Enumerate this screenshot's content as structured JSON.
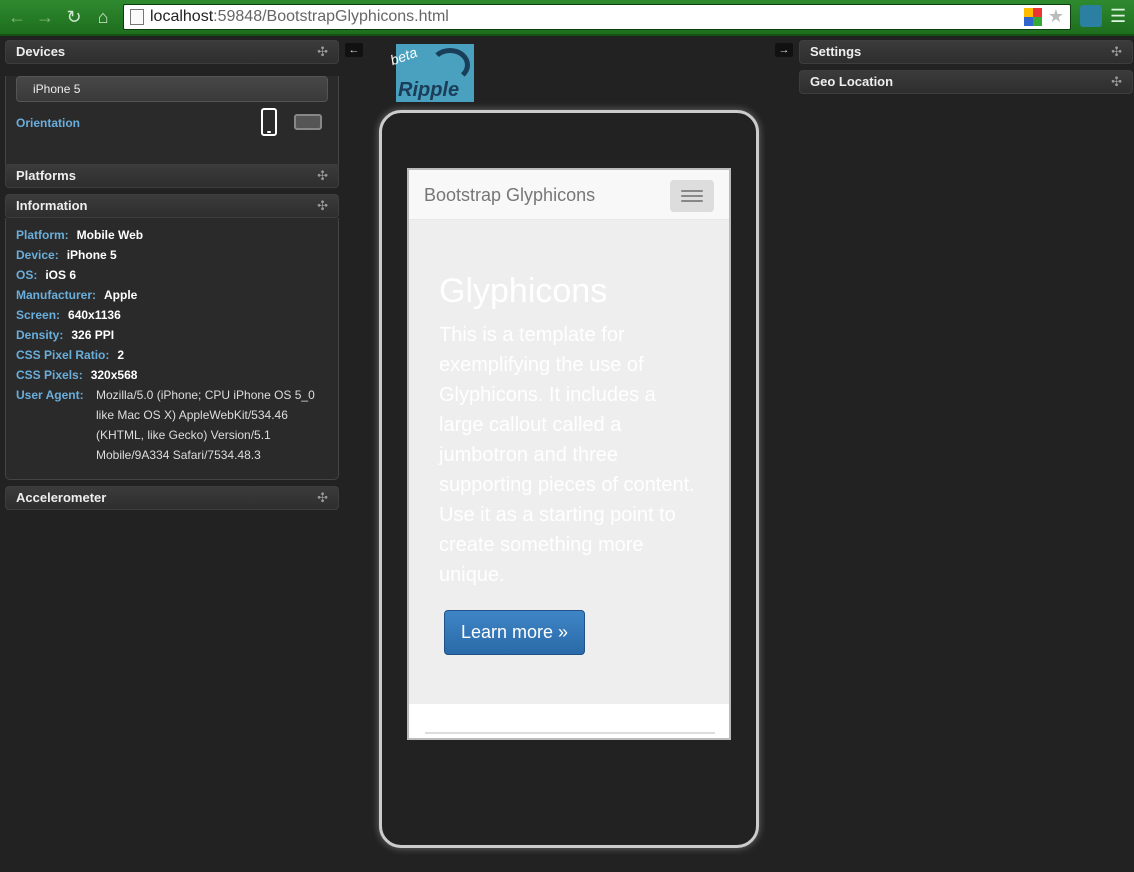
{
  "browser": {
    "url_host": "localhost",
    "url_rest": ":59848/BootstrapGlyphicons.html"
  },
  "left": {
    "devices": {
      "title": "Devices",
      "selected_device": "iPhone 5",
      "orientation_label": "Orientation"
    },
    "platforms": {
      "title": "Platforms"
    },
    "information": {
      "title": "Information",
      "rows": [
        {
          "key": "Platform:",
          "value": "Mobile Web"
        },
        {
          "key": "Device:",
          "value": "iPhone 5"
        },
        {
          "key": "OS:",
          "value": "iOS 6"
        },
        {
          "key": "Manufacturer:",
          "value": "Apple"
        },
        {
          "key": "Screen:",
          "value": "640x1136"
        },
        {
          "key": "Density:",
          "value": "326 PPI"
        },
        {
          "key": "CSS Pixel Ratio:",
          "value": "2"
        },
        {
          "key": "CSS Pixels:",
          "value": "320x568"
        }
      ],
      "user_agent_key": "User Agent:",
      "user_agent_lines": [
        "Mozilla/5.0 (iPhone; CPU iPhone OS 5_0",
        "like Mac OS X) AppleWebKit/534.46",
        "(KHTML, like Gecko) Version/5.1",
        "Mobile/9A334 Safari/7534.48.3"
      ]
    },
    "accelerometer": {
      "title": "Accelerometer"
    }
  },
  "right": {
    "settings": {
      "title": "Settings"
    },
    "geo": {
      "title": "Geo Location"
    }
  },
  "logo": {
    "text": "Ripple",
    "badge": "beta"
  },
  "app": {
    "brand": "Bootstrap Glyphicons",
    "heading": "Glyphicons",
    "lead": "This is a template for exemplifying the use of Glyphicons. It includes a large callout called a jumbotron and three supporting pieces of content. Use it as a starting point to create something more unique.",
    "button": "Learn more »"
  },
  "icons": {
    "back": "back-arrow-icon",
    "forward": "forward-arrow-icon",
    "reload": "reload-icon",
    "home": "home-icon",
    "collapse": "collapse-arrow-icon",
    "expand": "expand-arrow-icon"
  }
}
